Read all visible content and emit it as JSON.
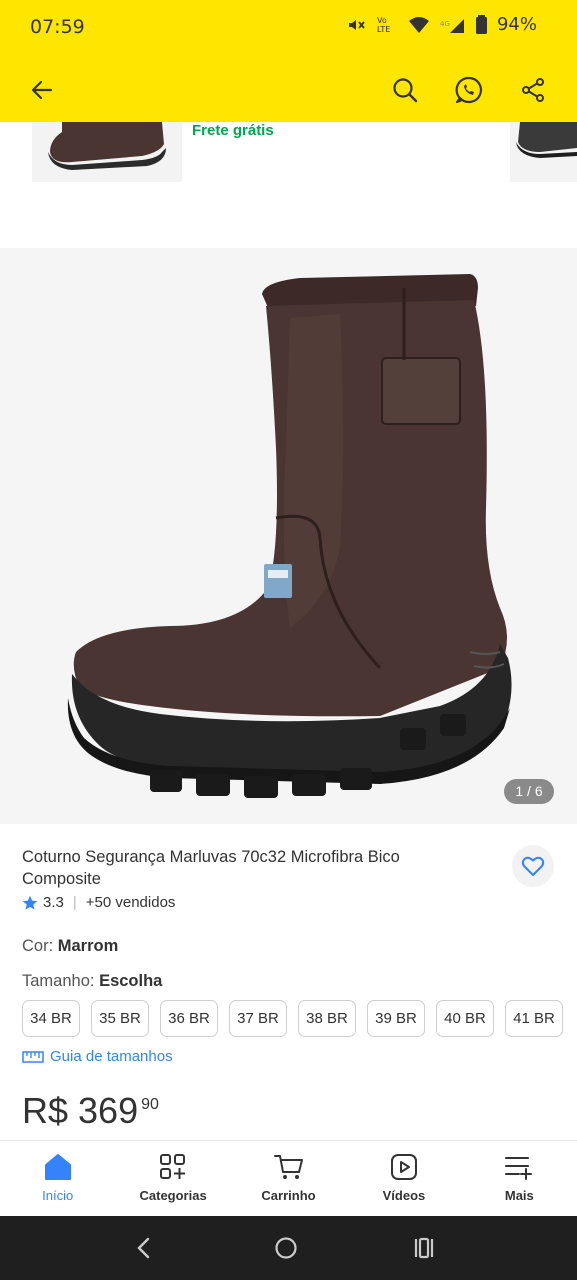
{
  "status_bar": {
    "time": "07:59",
    "battery": "94%",
    "network": "VoLTE 4G"
  },
  "app_bar": {
    "icons": [
      "arrow-left-icon",
      "search-icon",
      "whatsapp-icon",
      "share-icon"
    ]
  },
  "top_strip": {
    "shipping": "Frete grátis"
  },
  "gallery": {
    "counter": "1 / 6"
  },
  "product": {
    "title": "Coturno Segurança Marluvas 70c32 Microfibra Bico Composite",
    "rating": "3.3",
    "sold": "+50 vendidos",
    "color_label": "Cor:",
    "color_value": "Marrom",
    "size_label": "Tamanho:",
    "size_value": "Escolha",
    "sizes": [
      "34 BR",
      "35 BR",
      "36 BR",
      "37 BR",
      "38 BR",
      "39 BR",
      "40 BR",
      "41 BR"
    ],
    "size_guide": "Guia de tamanhos",
    "price_main": "R$ 369",
    "price_cents": "90"
  },
  "bottom_nav": [
    {
      "label": "Início",
      "icon": "home-icon",
      "active": true
    },
    {
      "label": "Categorias",
      "icon": "categories-icon",
      "active": false
    },
    {
      "label": "Carrinho",
      "icon": "cart-icon",
      "active": false
    },
    {
      "label": "Vídeos",
      "icon": "video-icon",
      "active": false
    },
    {
      "label": "Mais",
      "icon": "menu-plus-icon",
      "active": false
    }
  ],
  "colors": {
    "accent_yellow": "#ffe600",
    "brand_blue": "#3483fa",
    "shipping_green": "#00a650",
    "boot_brown": "#4a3532"
  }
}
